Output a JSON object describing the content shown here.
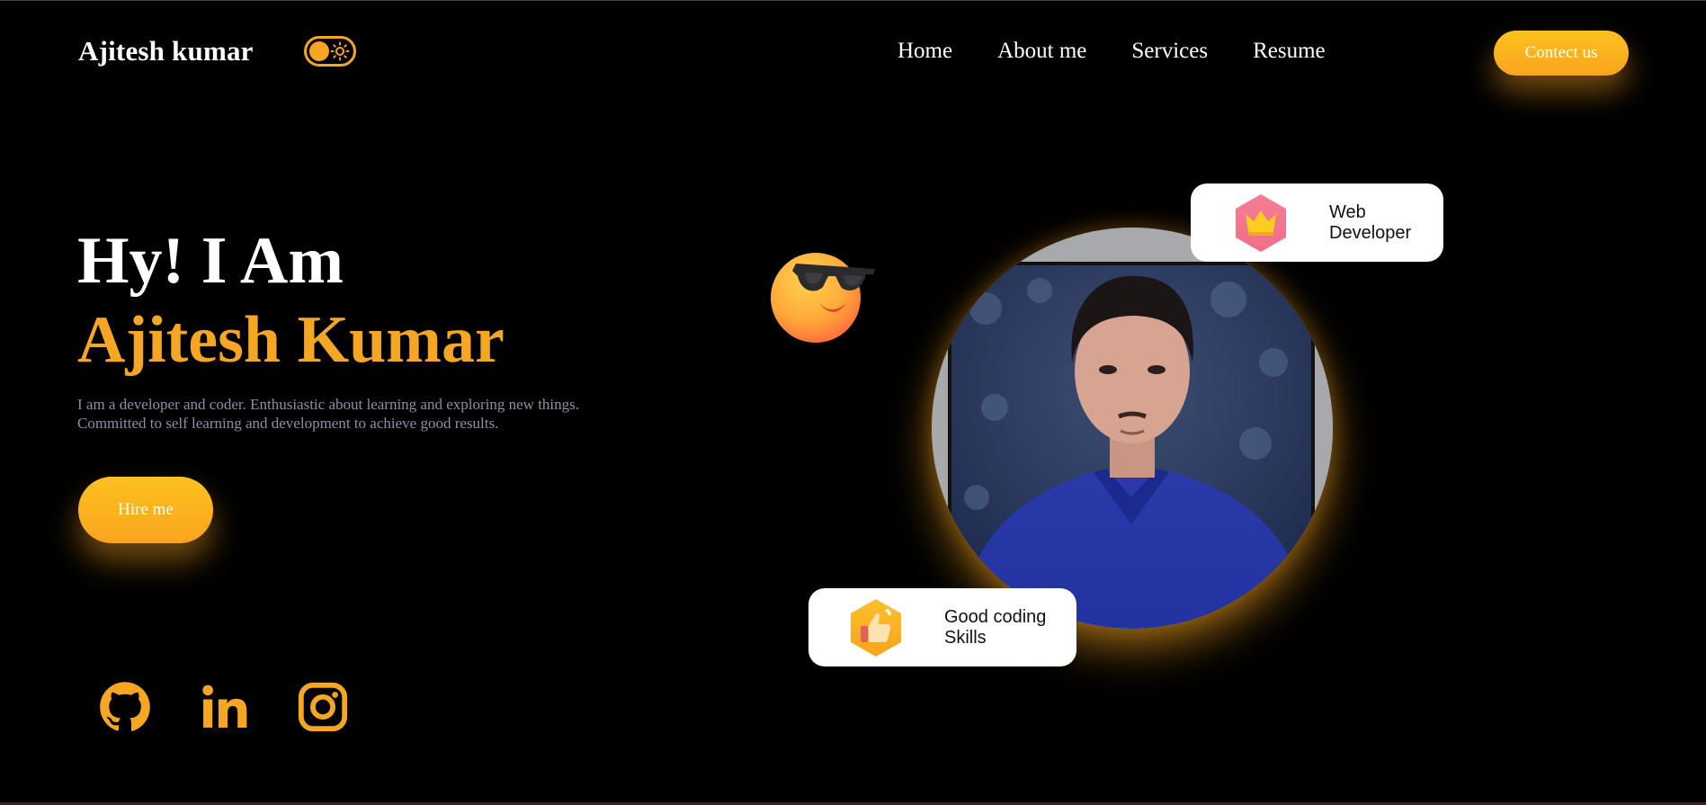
{
  "header": {
    "brand": "Ajitesh kumar",
    "theme_toggle_icon": "sun-icon",
    "nav": [
      "Home",
      "About me",
      "Services",
      "Resume"
    ],
    "contact_label": "Contect us"
  },
  "hero": {
    "intro": "Hy! I Am",
    "name": "Ajitesh Kumar",
    "description_line1": "I am a developer and coder. Enthusiastic about learning and exploring new things.",
    "description_line2": "Committed to self learning and development to achieve good results.",
    "hire_label": "Hire me"
  },
  "social": {
    "icons": [
      "github-icon",
      "linkedin-icon",
      "instagram-icon"
    ]
  },
  "cards": {
    "web": {
      "line1": "Web",
      "line2": "Developer",
      "icon": "crown-icon"
    },
    "coding": {
      "line1": "Good coding",
      "line2": "Skills",
      "icon": "thumbs-up-icon"
    }
  },
  "colors": {
    "accent": "#f5a623",
    "background": "#000000",
    "description": "#8891a8"
  }
}
